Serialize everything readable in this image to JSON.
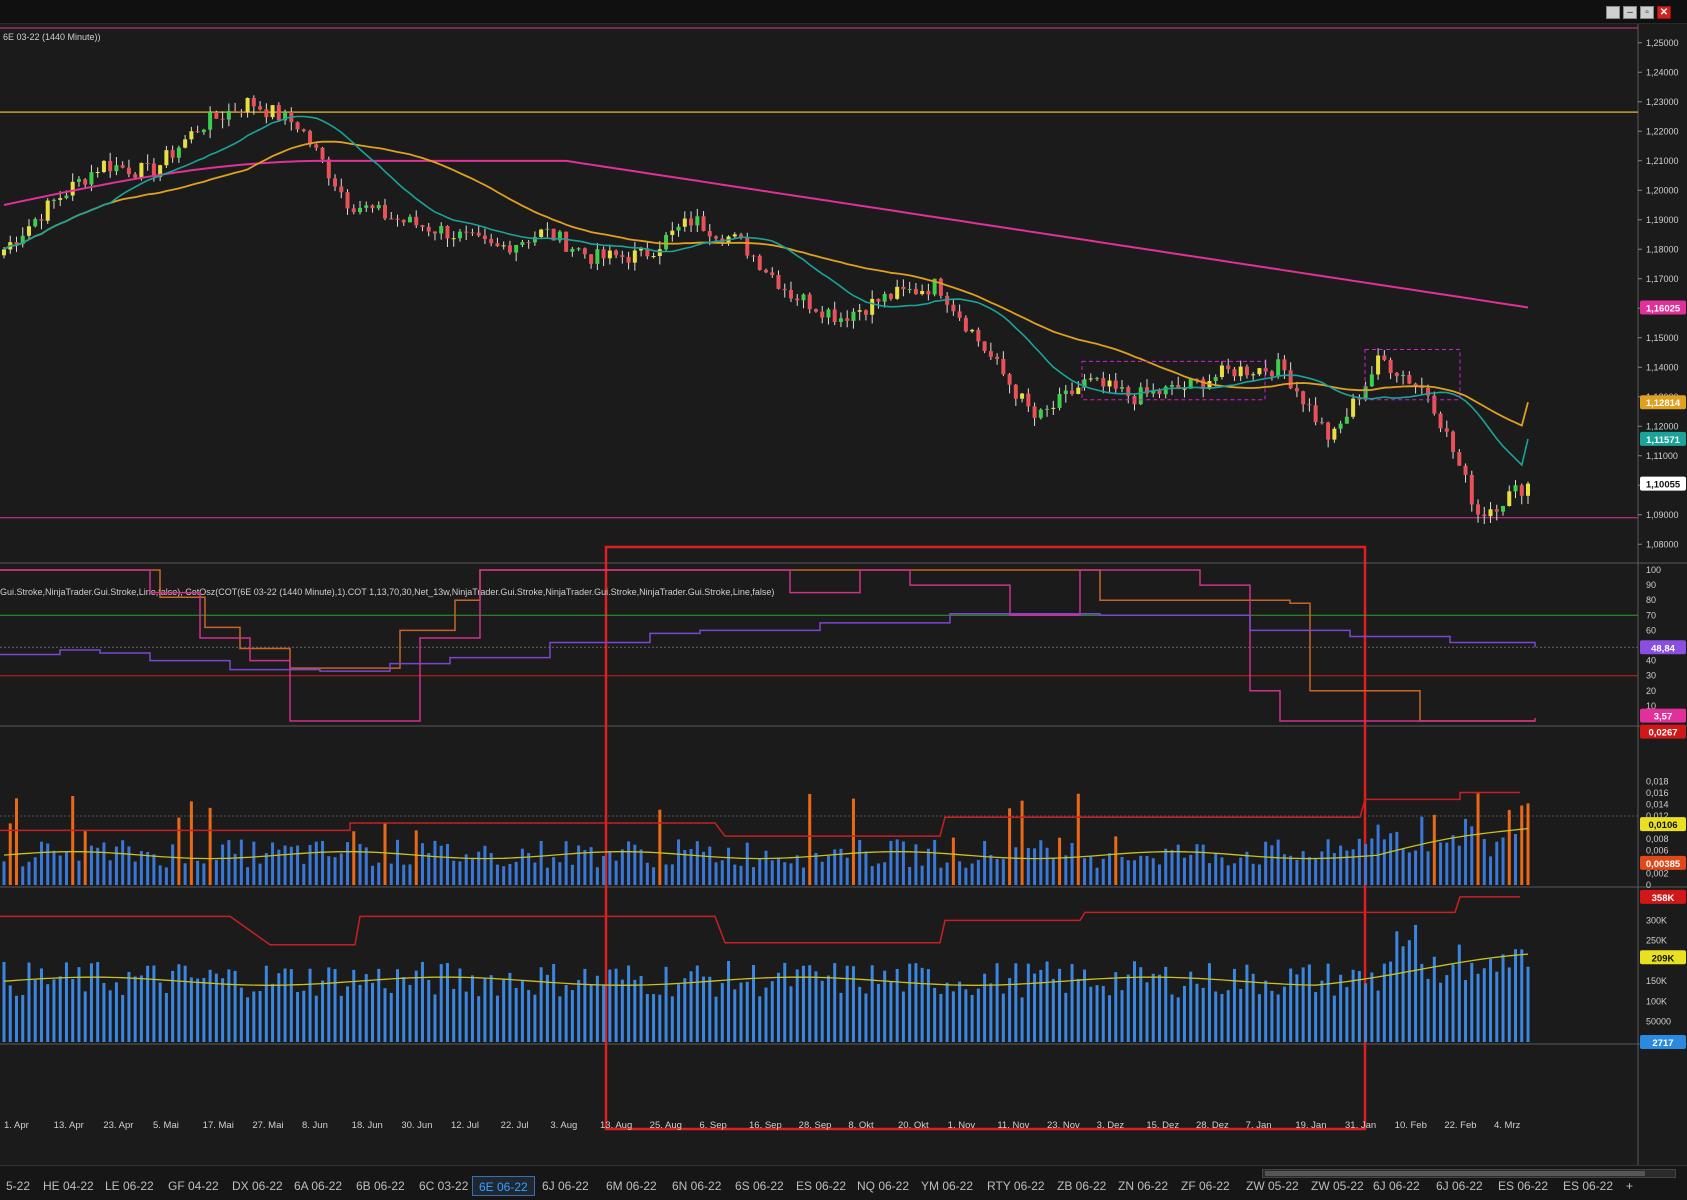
{
  "window": {
    "buttons": [
      "minimize",
      "restore",
      "maximize",
      "close"
    ]
  },
  "price_panel": {
    "title": "6E 03-22 (1440 Minute))",
    "y_ticks": [
      "1,25000",
      "1,24000",
      "1,23000",
      "1,22000",
      "1,21000",
      "1,20000",
      "1,19000",
      "1,18000",
      "1,17000",
      "1,16000",
      "1,15000",
      "1,14000",
      "1,13000",
      "1,12000",
      "1,11000",
      "1,10000",
      "1,09000",
      "1,08000"
    ],
    "badges": [
      {
        "label": "1,16025",
        "color": "#e0309a"
      },
      {
        "label": "1,12814",
        "color": "#e0a020"
      },
      {
        "label": "1,11571",
        "color": "#1aa39a"
      },
      {
        "label": "1,10055",
        "color": "#ffffff"
      }
    ]
  },
  "cot_panel": {
    "title": "Gui.Stroke,NinjaTrader.Gui.Stroke,Line,false), CotOsz(COT(6E 03-22 (1440 Minute),1).COT 1,13,70,30,Net_13w,NinjaTrader.Gui.Stroke,NinjaTrader.Gui.Stroke,NinjaTrader.Gui.Stroke,Line,false)",
    "y_ticks": [
      "100",
      "90",
      "80",
      "70",
      "60",
      "50",
      "40",
      "30",
      "20",
      "10"
    ],
    "badges": [
      {
        "label": "48,84",
        "color": "#8a4fe0"
      },
      {
        "label": "3,57",
        "color": "#e0309a"
      }
    ]
  },
  "range_panel": {
    "y_ticks": [
      "0,018",
      "0,016",
      "0,014",
      "0,012",
      "0,01",
      "0,008",
      "0,006",
      "0,004",
      "0,002",
      "0"
    ],
    "badges": [
      {
        "label": "0,0267",
        "color": "#d01818"
      },
      {
        "label": "0,0106",
        "color": "#e8e020"
      },
      {
        "label": "0,00385",
        "color": "#e04818"
      }
    ]
  },
  "volume_panel": {
    "y_ticks": [
      "300K",
      "250K",
      "200K",
      "150K",
      "100K",
      "50000"
    ],
    "badges": [
      {
        "label": "358K",
        "color": "#d01818"
      },
      {
        "label": "209K",
        "color": "#e8e020"
      },
      {
        "label": "2717",
        "color": "#2a8ae0"
      }
    ]
  },
  "x_axis_labels": [
    "1. Apr",
    "13. Apr",
    "23. Apr",
    "5. Mai",
    "17. Mai",
    "27. Mai",
    "8. Jun",
    "18. Jun",
    "30. Jun",
    "12. Jul",
    "22. Jul",
    "3. Aug",
    "13. Aug",
    "25. Aug",
    "6. Sep",
    "16. Sep",
    "28. Sep",
    "8. Okt",
    "20. Okt",
    "1. Nov",
    "11. Nov",
    "23. Nov",
    "3. Dez",
    "15. Dez",
    "28. Dez",
    "7. Jan",
    "19. Jan",
    "31. Jan",
    "10. Feb",
    "22. Feb",
    "4. Mrz"
  ],
  "tabs": [
    "5-22",
    "HE 04-22",
    "LE 06-22",
    "GF 04-22",
    "DX 06-22",
    "6A 06-22",
    "6B 06-22",
    "6C 03-22",
    "6E 06-22",
    "6J 06-22",
    "6M 06-22",
    "6N 06-22",
    "6S 06-22",
    "ES 06-22",
    "NQ 06-22",
    "YM 06-22",
    "RTY 06-22",
    "ZB 06-22",
    "ZN 06-22",
    "ZF 06-22",
    "ZW 05-22",
    "ZW 05-22",
    "6J 06-22",
    "6J 06-22",
    "ES 06-22",
    "ES 06-22",
    "+"
  ],
  "active_tab": "6E 06-22",
  "colors": {
    "background": "#1b1b1b",
    "bull": "#3ccf4e",
    "bear": "#e8505a",
    "neutral": "#e8e040",
    "sma_fast": "#1aa39a",
    "sma_mid": "#e0a020",
    "sma_slow": "#e0309a",
    "highlight_rect": "#e02020",
    "volume_bar": "#3a78d8",
    "volume_bar_high": "#e86a18"
  },
  "chart_data": {
    "type": "candlestick",
    "instrument": "6E 03-22",
    "timeframe": "1440 Minute",
    "price_ylim": [
      1.075,
      1.255
    ],
    "horizontal_lines": [
      1.2265,
      1.089
    ],
    "sma_slow_end": 1.16025,
    "sma_mid_end": 1.12814,
    "sma_fast_end": 1.11571,
    "last_price": 1.10055,
    "key_points": [
      {
        "x": "1. Apr",
        "close": 1.18
      },
      {
        "x": "13. Apr",
        "close": 1.196
      },
      {
        "x": "23. Apr",
        "close": 1.209
      },
      {
        "x": "5. Mai",
        "close": 1.206
      },
      {
        "x": "17. Mai",
        "close": 1.222
      },
      {
        "x": "27. Mai",
        "close": 1.23
      },
      {
        "x": "8. Jun",
        "close": 1.222
      },
      {
        "x": "18. Jun",
        "close": 1.196
      },
      {
        "x": "30. Jun",
        "close": 1.19
      },
      {
        "x": "12. Jul",
        "close": 1.186
      },
      {
        "x": "22. Jul",
        "close": 1.18
      },
      {
        "x": "3. Aug",
        "close": 1.186
      },
      {
        "x": "13. Aug",
        "close": 1.177
      },
      {
        "x": "25. Aug",
        "close": 1.178
      },
      {
        "x": "6. Sep",
        "close": 1.19
      },
      {
        "x": "16. Sep",
        "close": 1.182
      },
      {
        "x": "28. Sep",
        "close": 1.165
      },
      {
        "x": "8. Okt",
        "close": 1.157
      },
      {
        "x": "20. Okt",
        "close": 1.164
      },
      {
        "x": "1. Nov",
        "close": 1.168
      },
      {
        "x": "11. Nov",
        "close": 1.145
      },
      {
        "x": "23. Nov",
        "close": 1.122
      },
      {
        "x": "3. Dez",
        "close": 1.135
      },
      {
        "x": "15. Dez",
        "close": 1.13
      },
      {
        "x": "28. Dez",
        "close": 1.133
      },
      {
        "x": "7. Jan",
        "close": 1.139
      },
      {
        "x": "19. Jan",
        "close": 1.14
      },
      {
        "x": "31. Jan",
        "close": 1.115
      },
      {
        "x": "10. Feb",
        "close": 1.143
      },
      {
        "x": "22. Feb",
        "close": 1.131
      },
      {
        "x": "4. Mrz",
        "close": 1.09
      },
      {
        "x": "4. Mrz+",
        "close": 1.1006
      }
    ]
  }
}
